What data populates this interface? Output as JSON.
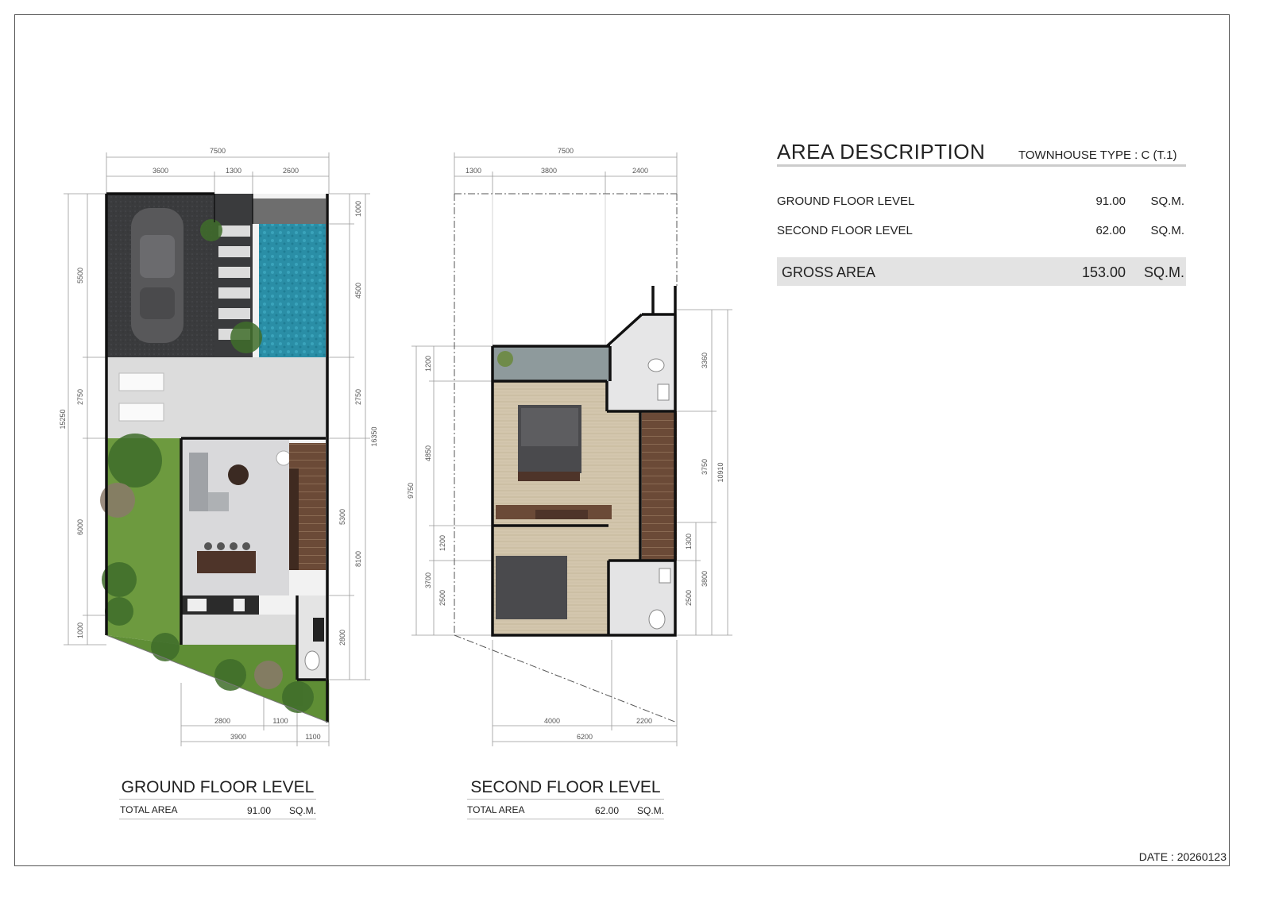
{
  "area_description": {
    "title": "AREA DESCRIPTION",
    "type_label": "TOWNHOUSE TYPE : C (T.1)",
    "rows": [
      {
        "label": "GROUND FLOOR LEVEL",
        "value": "91.00",
        "unit": "SQ.M."
      },
      {
        "label": "SECOND FLOOR LEVEL",
        "value": "62.00",
        "unit": "SQ.M."
      }
    ],
    "gross": {
      "label": "GROSS AREA",
      "value": "153.00",
      "unit": "SQ.M."
    }
  },
  "ground_floor": {
    "title": "GROUND FLOOR LEVEL",
    "total_label": "TOTAL AREA",
    "total_value": "91.00",
    "total_unit": "SQ.M.",
    "dims": {
      "top_total": "7500",
      "top_a": "3600",
      "top_b": "1300",
      "top_c": "2600",
      "left_total": "15250",
      "left_a": "5500",
      "left_b": "2750",
      "left_c": "6000",
      "left_d": "1000",
      "right_a": "1000",
      "right_b": "4500",
      "right_c": "2750",
      "right_d": "5300",
      "right_e": "2800",
      "right_f": "8100",
      "right_total": "16350",
      "bottom_a": "2800",
      "bottom_b": "1100",
      "bottom_c": "3900",
      "bottom_d": "1100"
    }
  },
  "second_floor": {
    "title": "SECOND FLOOR LEVEL",
    "total_label": "TOTAL AREA",
    "total_value": "62.00",
    "total_unit": "SQ.M.",
    "dims": {
      "top_total": "7500",
      "top_a": "1300",
      "top_b": "3800",
      "top_c": "2400",
      "left_a": "1200",
      "left_b": "4850",
      "left_c": "9750",
      "left_d": "1200",
      "left_e": "3700",
      "left_f": "2500",
      "right_a": "3360",
      "right_b": "3750",
      "right_c": "10910",
      "right_d": "1300",
      "right_e": "3800",
      "right_f": "2500",
      "bottom_a": "4000",
      "bottom_b": "2200",
      "bottom_c": "6200"
    }
  },
  "date": "DATE : 20260123"
}
